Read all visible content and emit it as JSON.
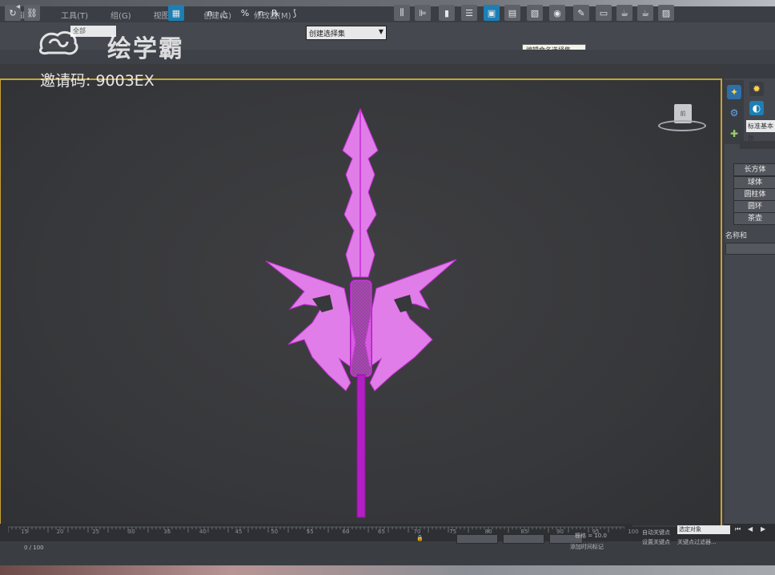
{
  "menubar": {
    "items": [
      "编辑(E)",
      "工具(T)",
      "组(G)",
      "视图(V)",
      "创建(C)",
      "修改器(M)"
    ]
  },
  "toolbar": {
    "name_field": "全部",
    "selection_set": "创建选择集",
    "tooltip": "编辑命名选择集"
  },
  "watermark": {
    "brand": "绘学霸",
    "invite_code": "邀请码: 9003EX"
  },
  "viewport": {
    "viewcube_label": "前",
    "model_color": "#e07de8",
    "wire_color": "#c42dd3",
    "border_color": "#c9a233"
  },
  "command_panel": {
    "object_type_field": "标准基本体",
    "object_buttons": [
      "长方体",
      "球体",
      "圆柱体",
      "圆环",
      "茶壶"
    ],
    "name_color_rollout": "名称和"
  },
  "timeline": {
    "tick_labels": [
      "15",
      "20",
      "25",
      "30",
      "35",
      "40",
      "45",
      "50",
      "55",
      "60",
      "65",
      "70",
      "75",
      "80",
      "85",
      "90",
      "95",
      "100"
    ],
    "frame_counter": "0 / 100"
  },
  "statusbar": {
    "grid_text": "栅格 = 10.0",
    "add_time_tag": "添加时间标记",
    "auto_key": "自动关键点",
    "set_key": "设置关键点",
    "key_filter": "选定对象",
    "key_filters_btn": "关键点过滤器..."
  }
}
